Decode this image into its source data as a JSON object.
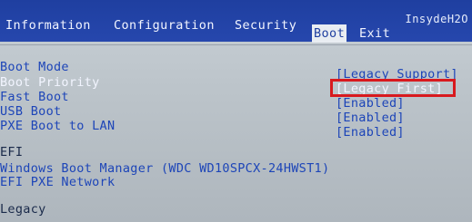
{
  "header": {
    "brand": "InsydeH2O",
    "tabs": [
      {
        "label": "Information",
        "active": false
      },
      {
        "label": "Configuration",
        "active": false
      },
      {
        "label": "Security",
        "active": false
      },
      {
        "label": "Boot",
        "active": true
      },
      {
        "label": "Exit",
        "active": false
      }
    ]
  },
  "settings": [
    {
      "label": "Boot Mode",
      "value": "[Legacy Support]"
    },
    {
      "label": "Boot Priority",
      "value": "[Legacy First]",
      "selected": true
    },
    {
      "label": "Fast Boot",
      "value": "[Enabled]"
    },
    {
      "label": "USB Boot",
      "value": "[Enabled]"
    },
    {
      "label": "PXE Boot to LAN",
      "value": "[Enabled]"
    }
  ],
  "efi": {
    "heading": "EFI",
    "items": [
      "Windows Boot Manager (WDC WD10SPCX-24HWST1)",
      "EFI PXE Network"
    ]
  },
  "legacy": {
    "heading": "Legacy"
  },
  "colors": {
    "header_blue": "#1f3fa0",
    "text_blue": "#1d45b8",
    "highlight_red": "#d8191e",
    "background": "#bcc4ca"
  }
}
